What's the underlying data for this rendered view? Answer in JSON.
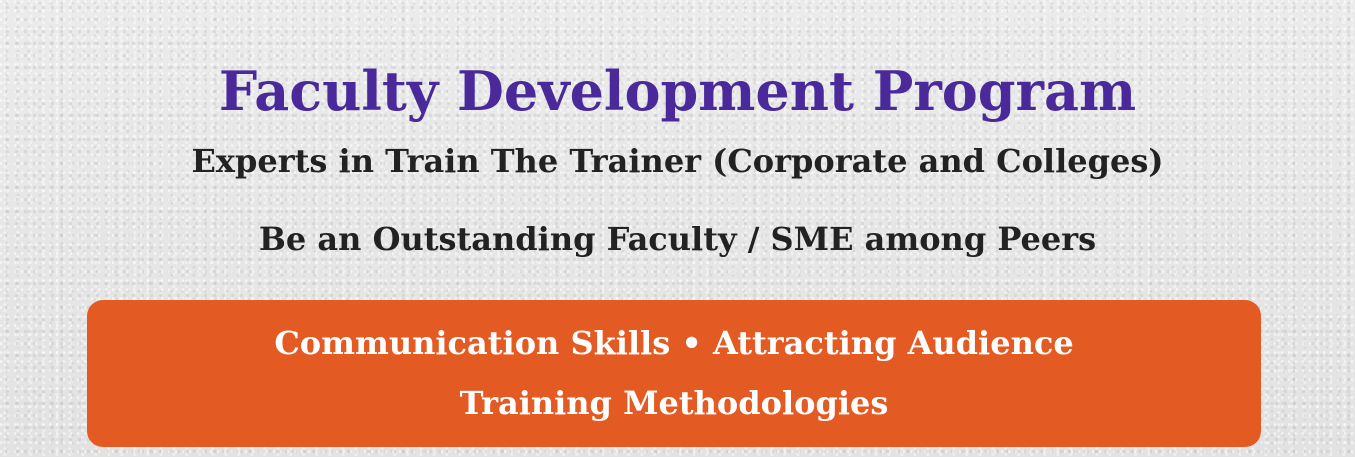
{
  "hero": {
    "title": "Faculty Development Program",
    "subtitle_1": "Experts in Train The Trainer (Corporate and Colleges)",
    "subtitle_2": "Be an Outstanding Faculty / SME among Peers"
  },
  "skills_banner": {
    "line_1": "Communication Skills • Attracting Audience",
    "line_2": "Training Methodologies"
  },
  "colors": {
    "title": "#4a2a9a",
    "body_text": "#222222",
    "banner_background": "#e35b23",
    "banner_text": "#ffffff",
    "page_background": "#e6e6e6"
  }
}
